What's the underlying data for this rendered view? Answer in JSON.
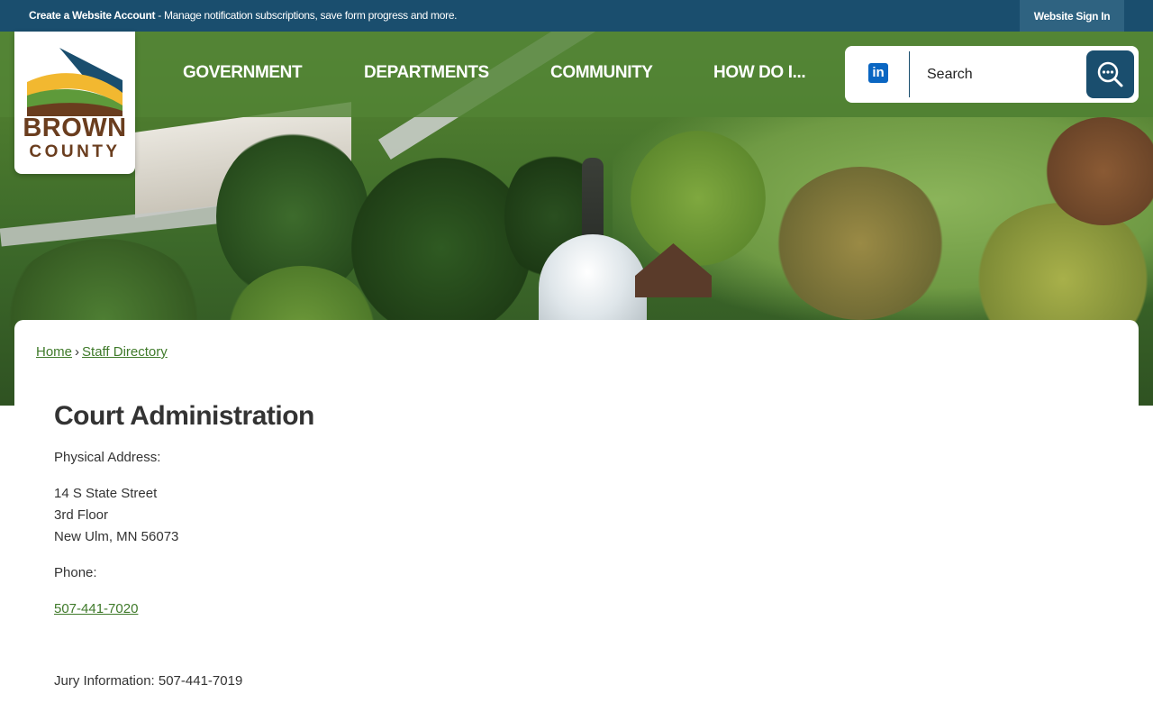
{
  "topbar": {
    "account_bold": "Create a Website Account",
    "account_rest": " - Manage notification subscriptions, save form progress and more.",
    "signin_label": "Website Sign In"
  },
  "logo": {
    "line1": "BROWN",
    "line2": "COUNTY"
  },
  "nav": {
    "items": [
      {
        "label": "GOVERNMENT"
      },
      {
        "label": "DEPARTMENTS"
      },
      {
        "label": "COMMUNITY"
      },
      {
        "label": "HOW DO I..."
      }
    ]
  },
  "search": {
    "linkedin_glyph": "in",
    "placeholder": "Search",
    "icon": "search-icon"
  },
  "breadcrumb": {
    "home": "Home",
    "separator": "›",
    "current": "Staff Directory"
  },
  "department": {
    "title": "Court Administration",
    "address_label": "Physical Address:",
    "address_line1": "14 S State Street",
    "address_line2": "3rd Floor",
    "address_line3": "New Ulm, MN 56073",
    "phone_label": "Phone:",
    "phone": "507-441-7020",
    "jury_info": "Jury Information: 507-441-7019"
  },
  "colors": {
    "topbar": "#1a4e6e",
    "nav_green": "#528434",
    "link_green": "#3f7a2a",
    "logo_brown": "#6a3d1e",
    "logo_yellow": "#f2b830",
    "logo_green": "#5e9a3a",
    "logo_blue": "#1a4e6e"
  }
}
